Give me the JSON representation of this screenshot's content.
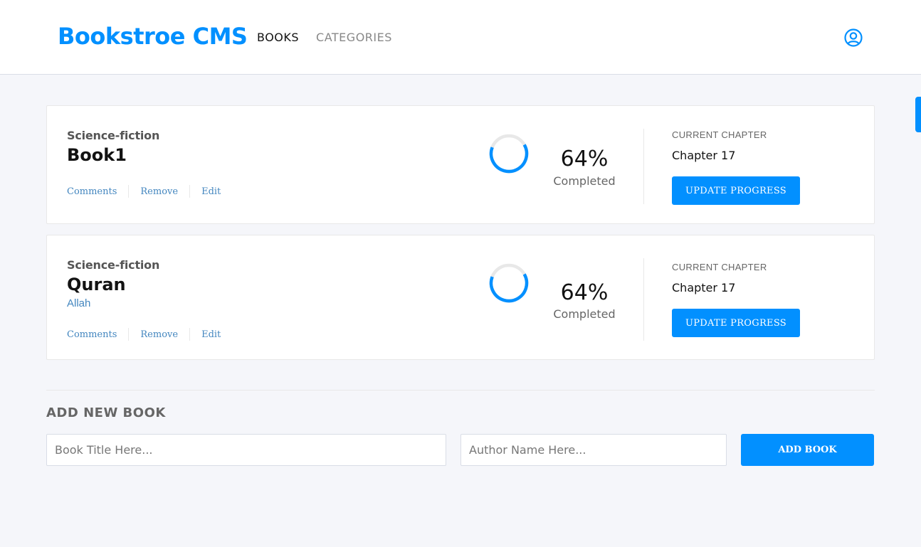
{
  "header": {
    "logo": "Bookstroe CMS",
    "nav": [
      {
        "label": "BOOKS"
      },
      {
        "label": "CATEGORIES"
      }
    ]
  },
  "books": [
    {
      "genre": "Science-fiction",
      "title": "Book1",
      "author": "",
      "actions": [
        "Comments",
        "Remove",
        "Edit"
      ],
      "progress_percent": 64,
      "percent_label": "64%",
      "completed_label": "Completed",
      "current_chapter_label": "CURRENT CHAPTER",
      "current_chapter": "Chapter 17",
      "update_label": "UPDATE PROGRESS"
    },
    {
      "genre": "Science-fiction",
      "title": "Quran",
      "author": "Allah",
      "actions": [
        "Comments",
        "Remove",
        "Edit"
      ],
      "progress_percent": 64,
      "percent_label": "64%",
      "completed_label": "Completed",
      "current_chapter_label": "CURRENT CHAPTER",
      "current_chapter": "Chapter 17",
      "update_label": "UPDATE PROGRESS"
    }
  ],
  "add_form": {
    "title": "ADD NEW BOOK",
    "title_placeholder": "Book Title Here...",
    "author_placeholder": "Author Name Here...",
    "submit_label": "ADD BOOK"
  },
  "colors": {
    "accent": "#0290ff",
    "link": "#4386bf",
    "background": "#f5f6fa"
  },
  "icons": {
    "user": "user-circle-icon"
  }
}
